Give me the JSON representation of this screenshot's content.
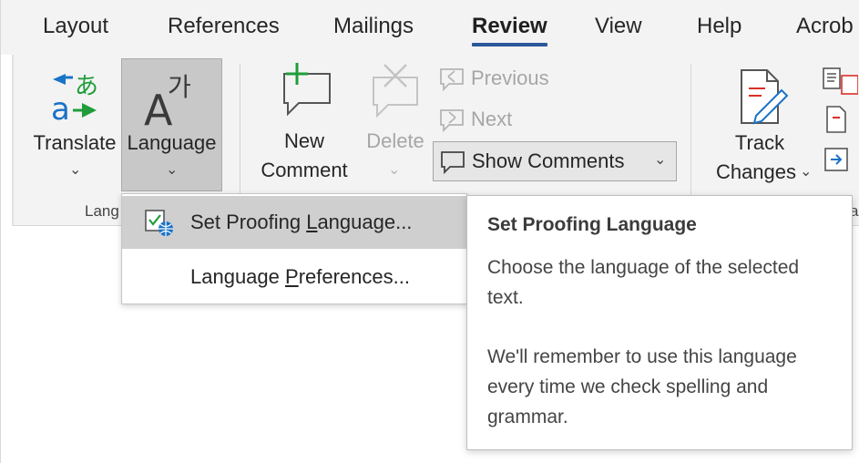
{
  "tabs": [
    {
      "label": "Layout"
    },
    {
      "label": "References"
    },
    {
      "label": "Mailings"
    },
    {
      "label": "Review",
      "active": true
    },
    {
      "label": "View"
    },
    {
      "label": "Help"
    },
    {
      "label": "Acrob"
    }
  ],
  "ribbon": {
    "translate": {
      "label": "Translate",
      "icon": "translate-icon"
    },
    "language": {
      "label": "Language",
      "icon": "language-icon",
      "pressed": true
    },
    "group_language_label": "Lang",
    "new_comment": {
      "line1": "New",
      "line2": "Comment",
      "icon": "new-comment-icon"
    },
    "delete": {
      "label": "Delete",
      "icon": "delete-comment-icon",
      "disabled": true
    },
    "previous": {
      "label": "Previous",
      "icon": "previous-comment-icon",
      "disabled": true
    },
    "next": {
      "label": "Next",
      "icon": "next-comment-icon",
      "disabled": true
    },
    "show_comments": {
      "label": "Show Comments",
      "icon": "show-comments-icon"
    },
    "track_changes": {
      "line1": "Track",
      "line2": "Changes",
      "icon": "track-changes-icon"
    },
    "right_edge_group_label_fragment": "a"
  },
  "menu": {
    "items": [
      {
        "pre": "Set Proofing ",
        "key": "L",
        "post": "anguage...",
        "icon": "proofing-language-icon",
        "hovered": true
      },
      {
        "pre": "Language ",
        "key": "P",
        "post": "references..."
      }
    ]
  },
  "tooltip": {
    "title": "Set Proofing Language",
    "para1": "Choose the language of the selected text.",
    "para2": "We'll remember to use this language every time we check spelling and grammar."
  },
  "colors": {
    "accent": "#2b579a",
    "green": "#1f9d3a",
    "blue": "#1a73c6",
    "ribbon_bg": "#f3f3f3",
    "pressed_bg": "#c8c8c8"
  }
}
